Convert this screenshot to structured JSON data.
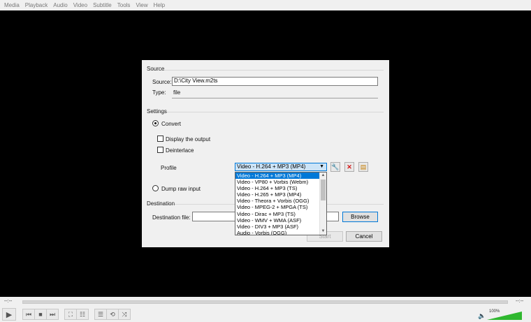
{
  "menubar": {
    "items": [
      "Media",
      "Playback",
      "Audio",
      "Video",
      "Subtitle",
      "Tools",
      "View",
      "Help"
    ]
  },
  "dialog": {
    "source_group": "Source",
    "source_label": "Source:",
    "source_value": "D:\\City View.m2ts",
    "type_label": "Type:",
    "type_value": "file",
    "settings_group": "Settings",
    "convert_label": "Convert",
    "display_output_label": "Display the output",
    "deinterlace_label": "Deinterlace",
    "profile_label": "Profile",
    "profile_selected": "Video - H.264 + MP3 (MP4)",
    "profile_options": [
      "Video - H.264 + MP3 (MP4)",
      "Video - VP80 + Vorbis (Webm)",
      "Video - H.264 + MP3 (TS)",
      "Video - H.265 + MP3 (MP4)",
      "Video - Theora + Vorbis (OGG)",
      "Video - MPEG-2 + MPGA (TS)",
      "Video - Dirac + MP3 (TS)",
      "Video - WMV + WMA (ASF)",
      "Video - DIV3 + MP3 (ASF)",
      "Audio - Vorbis (OGG)"
    ],
    "dump_raw_label": "Dump raw input",
    "destination_group": "Destination",
    "destination_file_label": "Destination file:",
    "destination_value": "",
    "browse_label": "Browse",
    "start_label": "Start",
    "cancel_label": "Cancel"
  },
  "player": {
    "time_elapsed": "--:--",
    "time_total": "--:--",
    "volume_label": "100%",
    "volume_level": 1.0
  },
  "colors": {
    "accent": "#0078d7",
    "volume_green": "#2fb82f"
  }
}
